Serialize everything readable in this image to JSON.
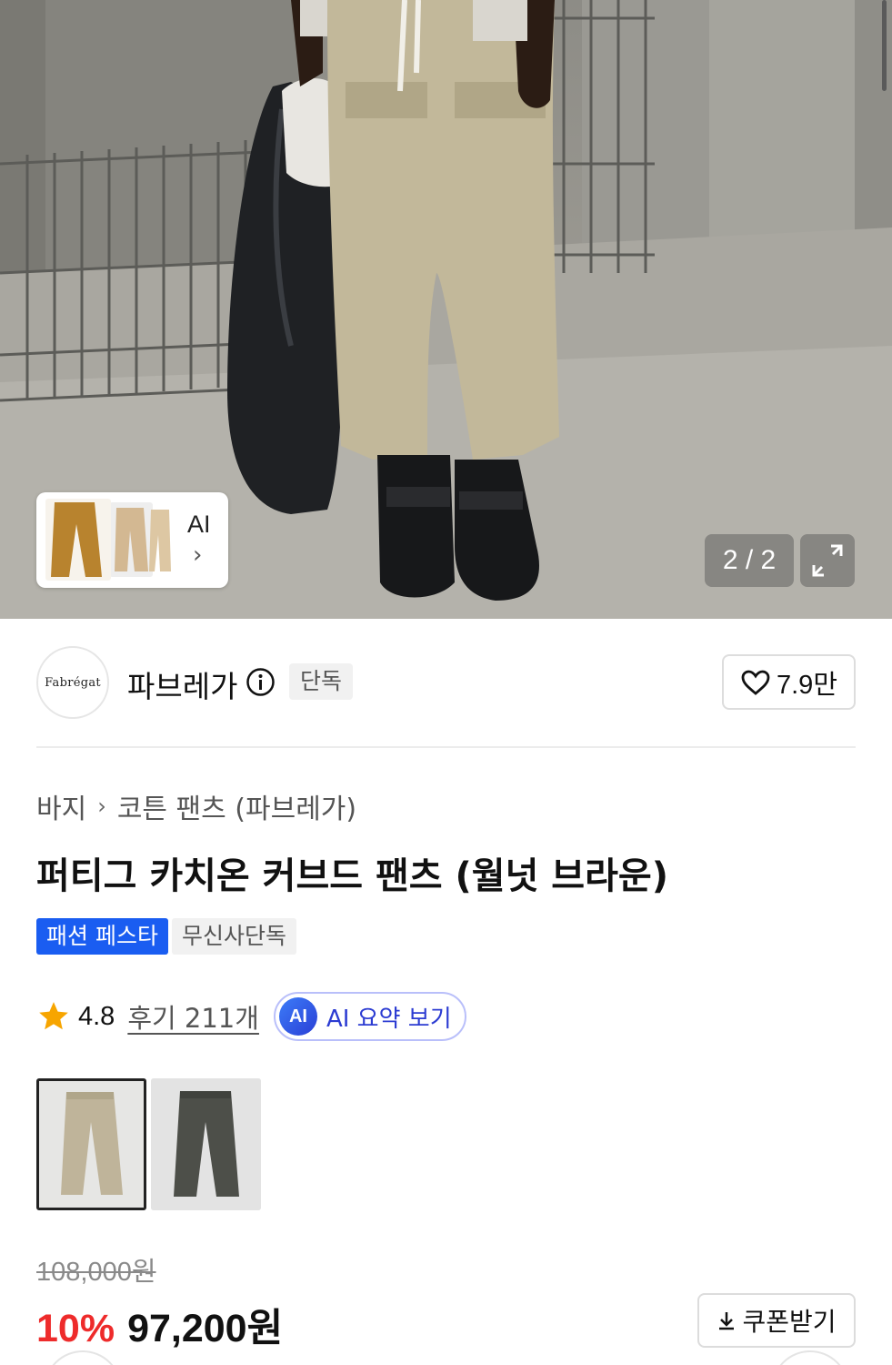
{
  "gallery": {
    "counter": "2 / 2",
    "ai_button_label": "AI",
    "scene_icon": "product-photo"
  },
  "brand": {
    "logo_text": "Fabrégat",
    "name": "파브레가",
    "exclusive_tag": "단독",
    "likes": "7.9만"
  },
  "breadcrumb": {
    "category": "바지",
    "subcategory": "코튼 팬츠 (파브레가)"
  },
  "product": {
    "title": "퍼티그 카치온 커브드 팬츠 (월넛 브라운)",
    "badges": {
      "festa": "패션 페스타",
      "exclusive": "무신사단독"
    }
  },
  "rating": {
    "score": "4.8",
    "reviews": "후기 211개",
    "ai_badge": "AI",
    "ai_summary": "AI 요약 보기"
  },
  "price": {
    "original": "108,000원",
    "discount": "10%",
    "final_number": "97,200",
    "final_unit": "원",
    "coupon_label": "쿠폰받기"
  },
  "colors": {
    "accent": "#1a5df1",
    "sale": "#ee2b2b",
    "ai": "#2c3cd2"
  }
}
